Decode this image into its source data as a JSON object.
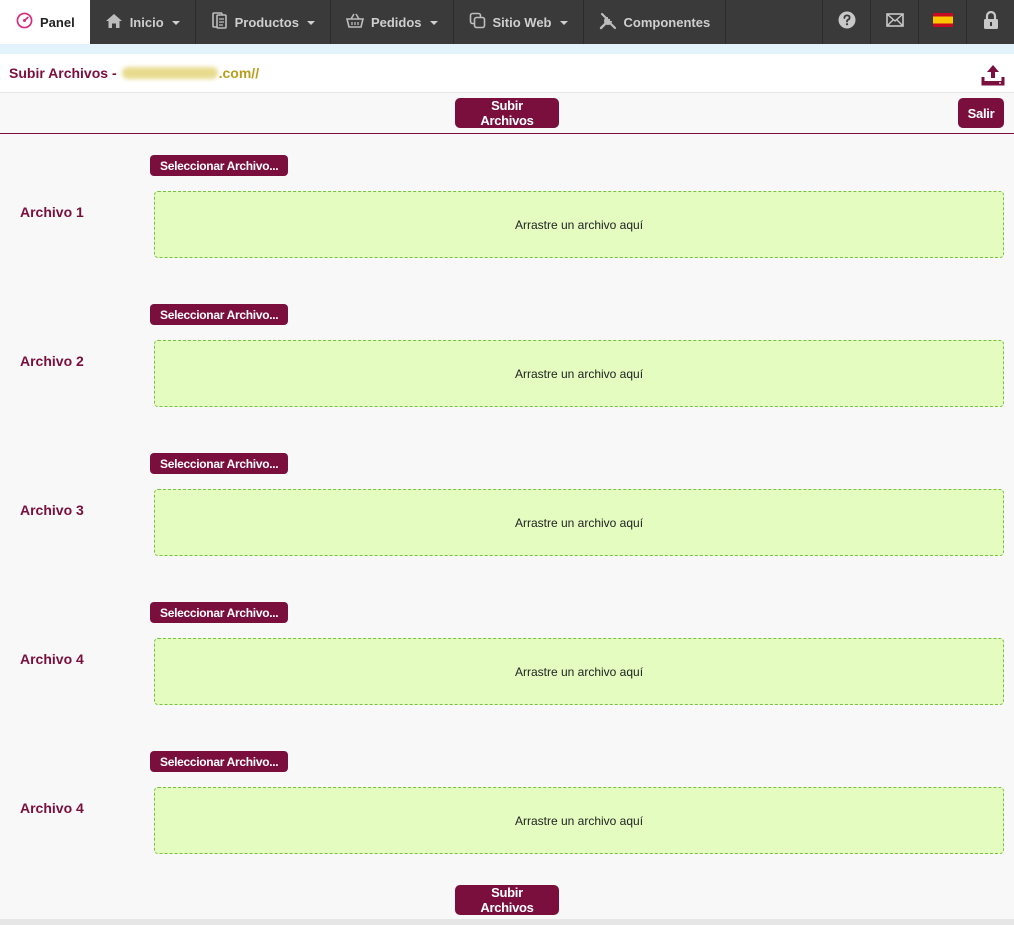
{
  "nav": {
    "panel": "Panel",
    "inicio": "Inicio",
    "productos": "Productos",
    "pedidos": "Pedidos",
    "sitio_web": "Sitio Web",
    "componentes": "Componentes"
  },
  "header": {
    "title": "Subir Archivos - ",
    "site_suffix": ".com//"
  },
  "actions": {
    "upload_label": "Subir Archivos",
    "exit_label": "Salir"
  },
  "files": [
    {
      "label": "Archivo 1",
      "select_label": "Seleccionar Archivo...",
      "drop_text": "Arrastre un archivo aquí"
    },
    {
      "label": "Archivo 2",
      "select_label": "Seleccionar Archivo...",
      "drop_text": "Arrastre un archivo aquí"
    },
    {
      "label": "Archivo 3",
      "select_label": "Seleccionar Archivo...",
      "drop_text": "Arrastre un archivo aquí"
    },
    {
      "label": "Archivo 4",
      "select_label": "Seleccionar Archivo...",
      "drop_text": "Arrastre un archivo aquí"
    },
    {
      "label": "Archivo 4",
      "select_label": "Seleccionar Archivo...",
      "drop_text": "Arrastre un archivo aquí"
    }
  ],
  "colors": {
    "accent": "#7a0f3d",
    "dropzone_bg": "#e4fcc0",
    "dropzone_border": "#7cc043",
    "nav_bg": "#3a3a3a"
  },
  "icons": [
    "panel-dashboard-icon",
    "home-icon",
    "products-icon",
    "basket-icon",
    "copy-icon",
    "tools-icon",
    "help-icon",
    "mail-icon",
    "spain-flag-icon",
    "lock-icon",
    "upload-icon"
  ]
}
